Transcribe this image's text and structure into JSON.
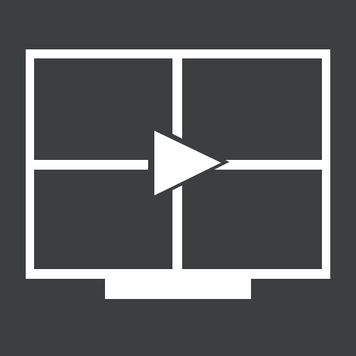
{
  "icon": {
    "name": "video-wall-play-icon",
    "background_color": "#3d3e40",
    "stroke_color": "#ffffff",
    "panel_fill": "#3d3e40",
    "play_fill": "#ffffff"
  }
}
